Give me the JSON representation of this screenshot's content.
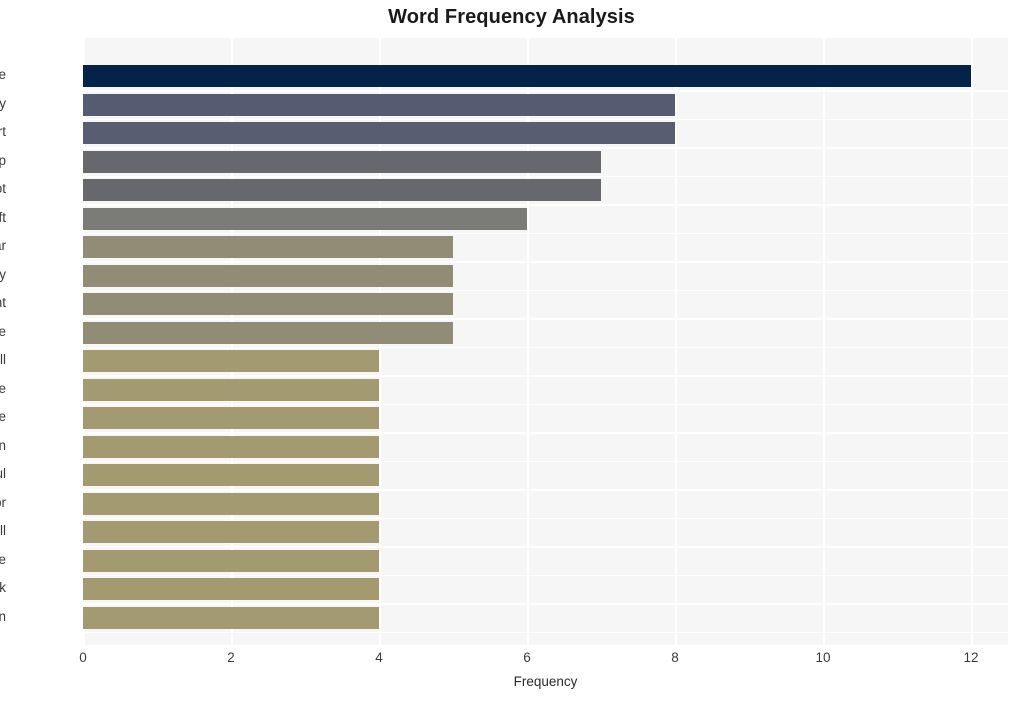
{
  "chart_data": {
    "type": "bar",
    "orientation": "horizontal",
    "title": "Word Frequency Analysis",
    "xlabel": "Frequency",
    "ylabel": "",
    "xlim": [
      0,
      12.5
    ],
    "xticks": [
      0,
      2,
      4,
      6,
      8,
      10,
      12
    ],
    "xtick_labels": [
      "0",
      "2",
      "4",
      "6",
      "8",
      "10",
      "12"
    ],
    "grid": true,
    "legend": null,
    "categories": [
      "image",
      "getty",
      "art",
      "trump",
      "ballot",
      "theft",
      "hear",
      "today",
      "president",
      "people",
      "kill",
      "enlarge",
      "toggle",
      "caption",
      "paul",
      "npr",
      "tell",
      "state",
      "attack",
      "khan"
    ],
    "values": [
      12,
      8,
      8,
      7,
      7,
      6,
      5,
      5,
      5,
      5,
      4,
      4,
      4,
      4,
      4,
      4,
      4,
      4,
      4,
      4
    ],
    "bar_colors": [
      "#042349",
      "#555b70",
      "#585d71",
      "#67676e",
      "#67676e",
      "#7b7b78",
      "#918c76",
      "#918c76",
      "#918c76",
      "#918c76",
      "#a39a70",
      "#a39a70",
      "#a39a70",
      "#a39a70",
      "#a39a70",
      "#a39a70",
      "#a39a70",
      "#a39a70",
      "#a39a70",
      "#a39a70"
    ],
    "plot_background": "#f6f6f7",
    "grid_color": "#ffffff",
    "figure_background": "#ffffff"
  }
}
